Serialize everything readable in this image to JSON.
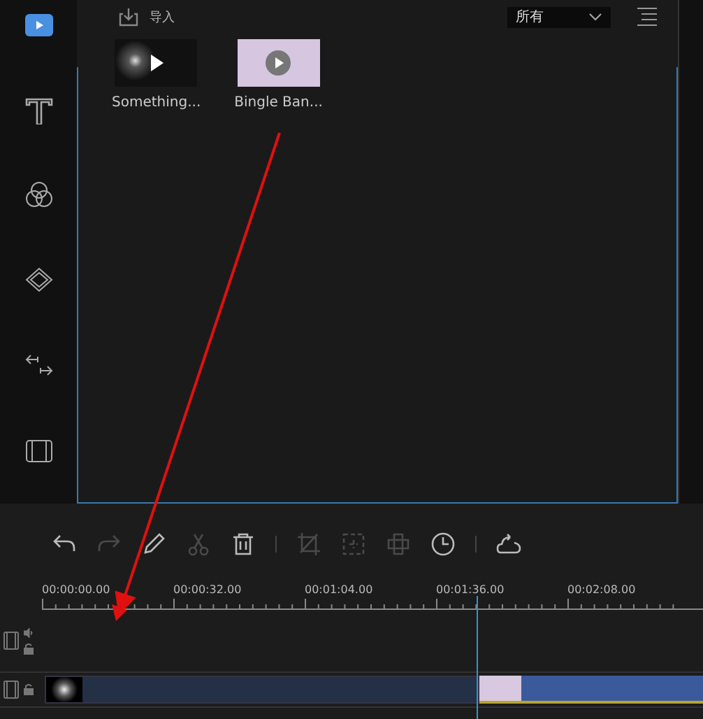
{
  "sidebar": {
    "items": [
      {
        "kind": "media",
        "selected": true
      },
      {
        "kind": "text",
        "selected": false
      },
      {
        "kind": "filters",
        "selected": false
      },
      {
        "kind": "overlays",
        "selected": false
      },
      {
        "kind": "transitions",
        "selected": false
      },
      {
        "kind": "elements",
        "selected": false
      }
    ]
  },
  "media_panel": {
    "import_label": "导入",
    "filter": "所有",
    "items": [
      {
        "name": "Something...",
        "kind": "dark"
      },
      {
        "name": "Bingle Ban...",
        "kind": "light"
      }
    ]
  },
  "toolbar": [
    {
      "kind": "undo",
      "disabled": false
    },
    {
      "kind": "redo",
      "disabled": true
    },
    {
      "kind": "pencil",
      "disabled": false
    },
    {
      "kind": "scissors",
      "disabled": true
    },
    {
      "kind": "trash",
      "disabled": false
    },
    {
      "kind": "sep"
    },
    {
      "kind": "crop",
      "disabled": true
    },
    {
      "kind": "zoom",
      "disabled": true
    },
    {
      "kind": "mosaic",
      "disabled": true
    },
    {
      "kind": "clock",
      "disabled": false
    },
    {
      "kind": "sep"
    },
    {
      "kind": "export",
      "disabled": false
    }
  ],
  "timeline": {
    "ruler": [
      "00:00:00.00",
      "00:00:32.00",
      "00:01:04.00",
      "00:01:36.00",
      "00:02:08.00"
    ],
    "playhead": {
      "level": 0.657
    },
    "tracks": [
      {
        "kind": "overlay"
      },
      {
        "kind": "video",
        "clips": [
          {
            "kind": "dark"
          },
          {
            "kind": "light"
          }
        ]
      }
    ]
  }
}
